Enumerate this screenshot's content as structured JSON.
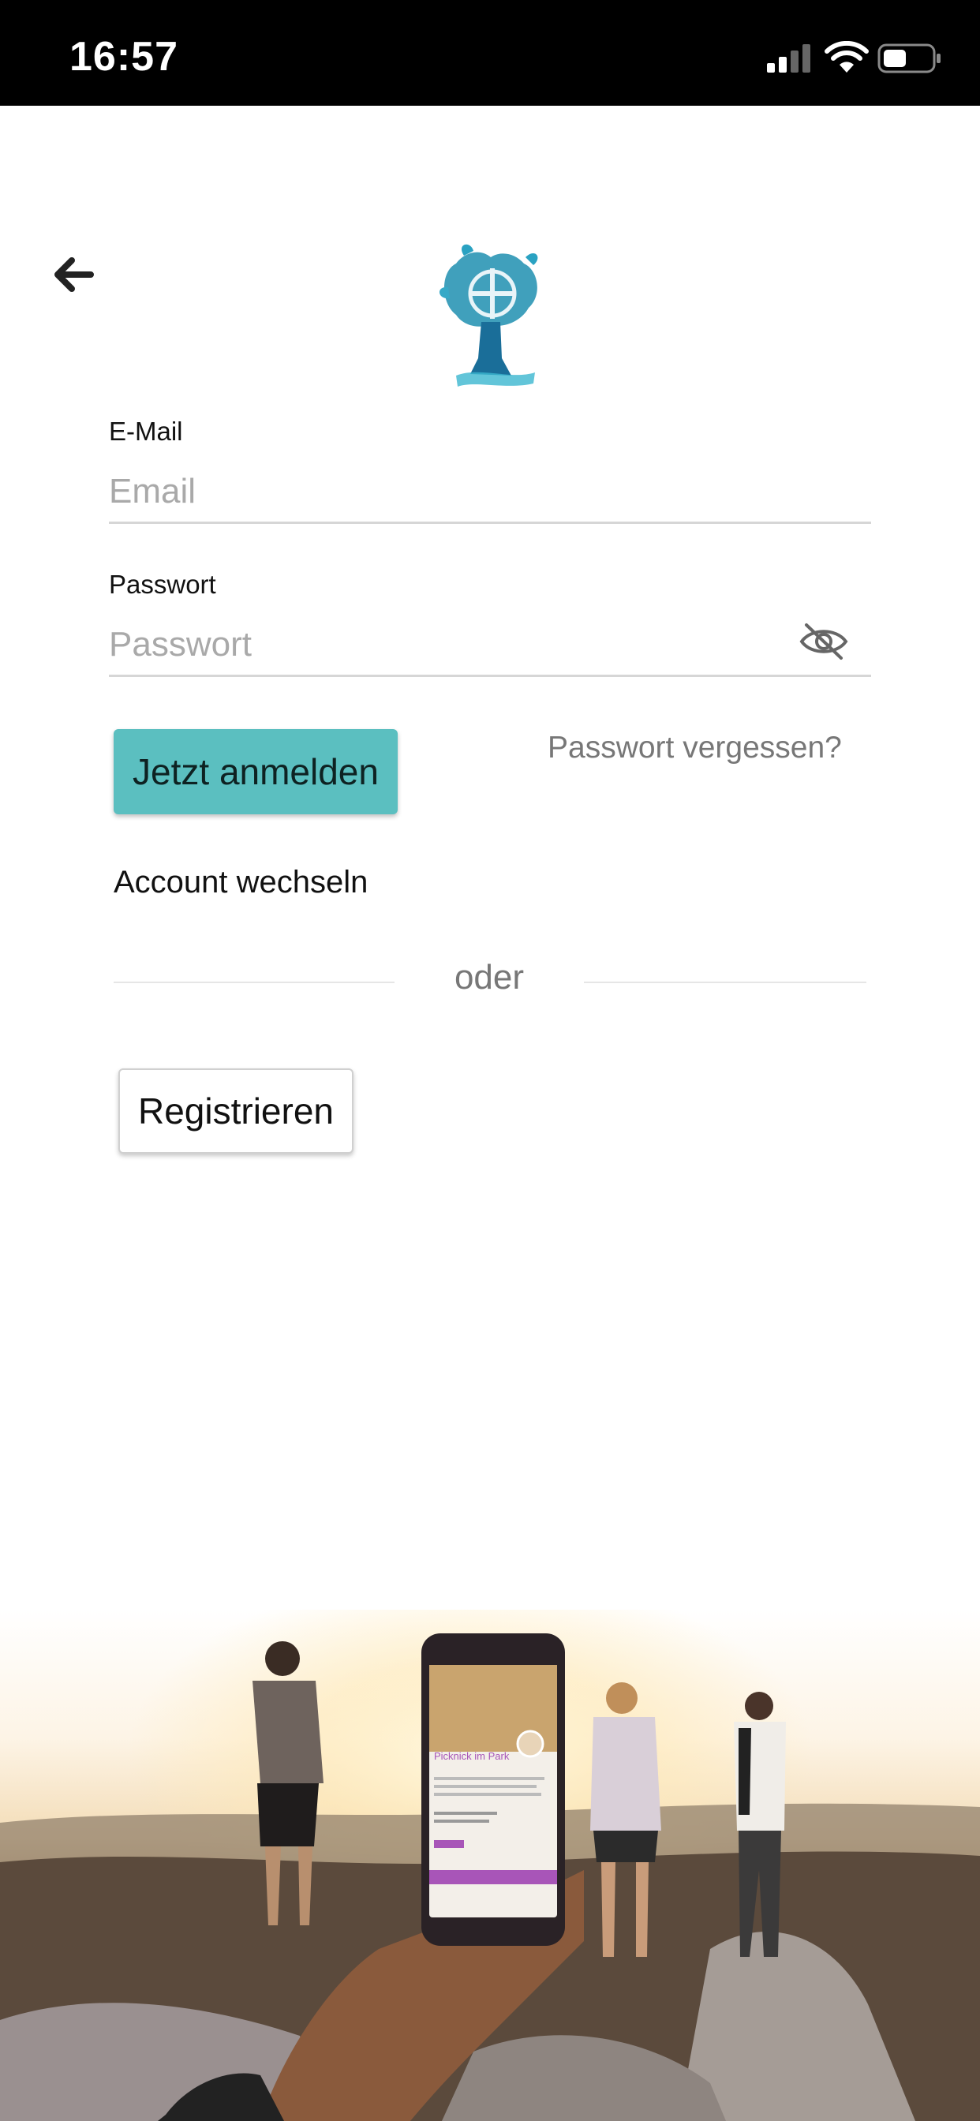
{
  "status_bar": {
    "time": "16:57",
    "icons": [
      "signal-icon",
      "wifi-icon",
      "battery-icon"
    ]
  },
  "navigation": {
    "back_icon": "arrow-left-icon"
  },
  "logo": {
    "icon": "tree-cross-logo"
  },
  "form": {
    "email": {
      "label": "E-Mail",
      "placeholder": "Email",
      "value": ""
    },
    "password": {
      "label": "Passwort",
      "placeholder": "Passwort",
      "value": "",
      "toggle_icon": "eye-off-icon"
    },
    "login_button": "Jetzt anmelden",
    "forgot_password": "Passwort vergessen?",
    "switch_account": "Account wechseln",
    "divider_text": "oder",
    "register_button": "Registrieren"
  },
  "hero": {
    "phone_screen_title": "Picknick im Park"
  },
  "colors": {
    "accent": "#5bbfc0",
    "status_bar_bg": "#000000",
    "phone_accent": "#a855b8",
    "logo_blue": "#1f8fb0"
  }
}
